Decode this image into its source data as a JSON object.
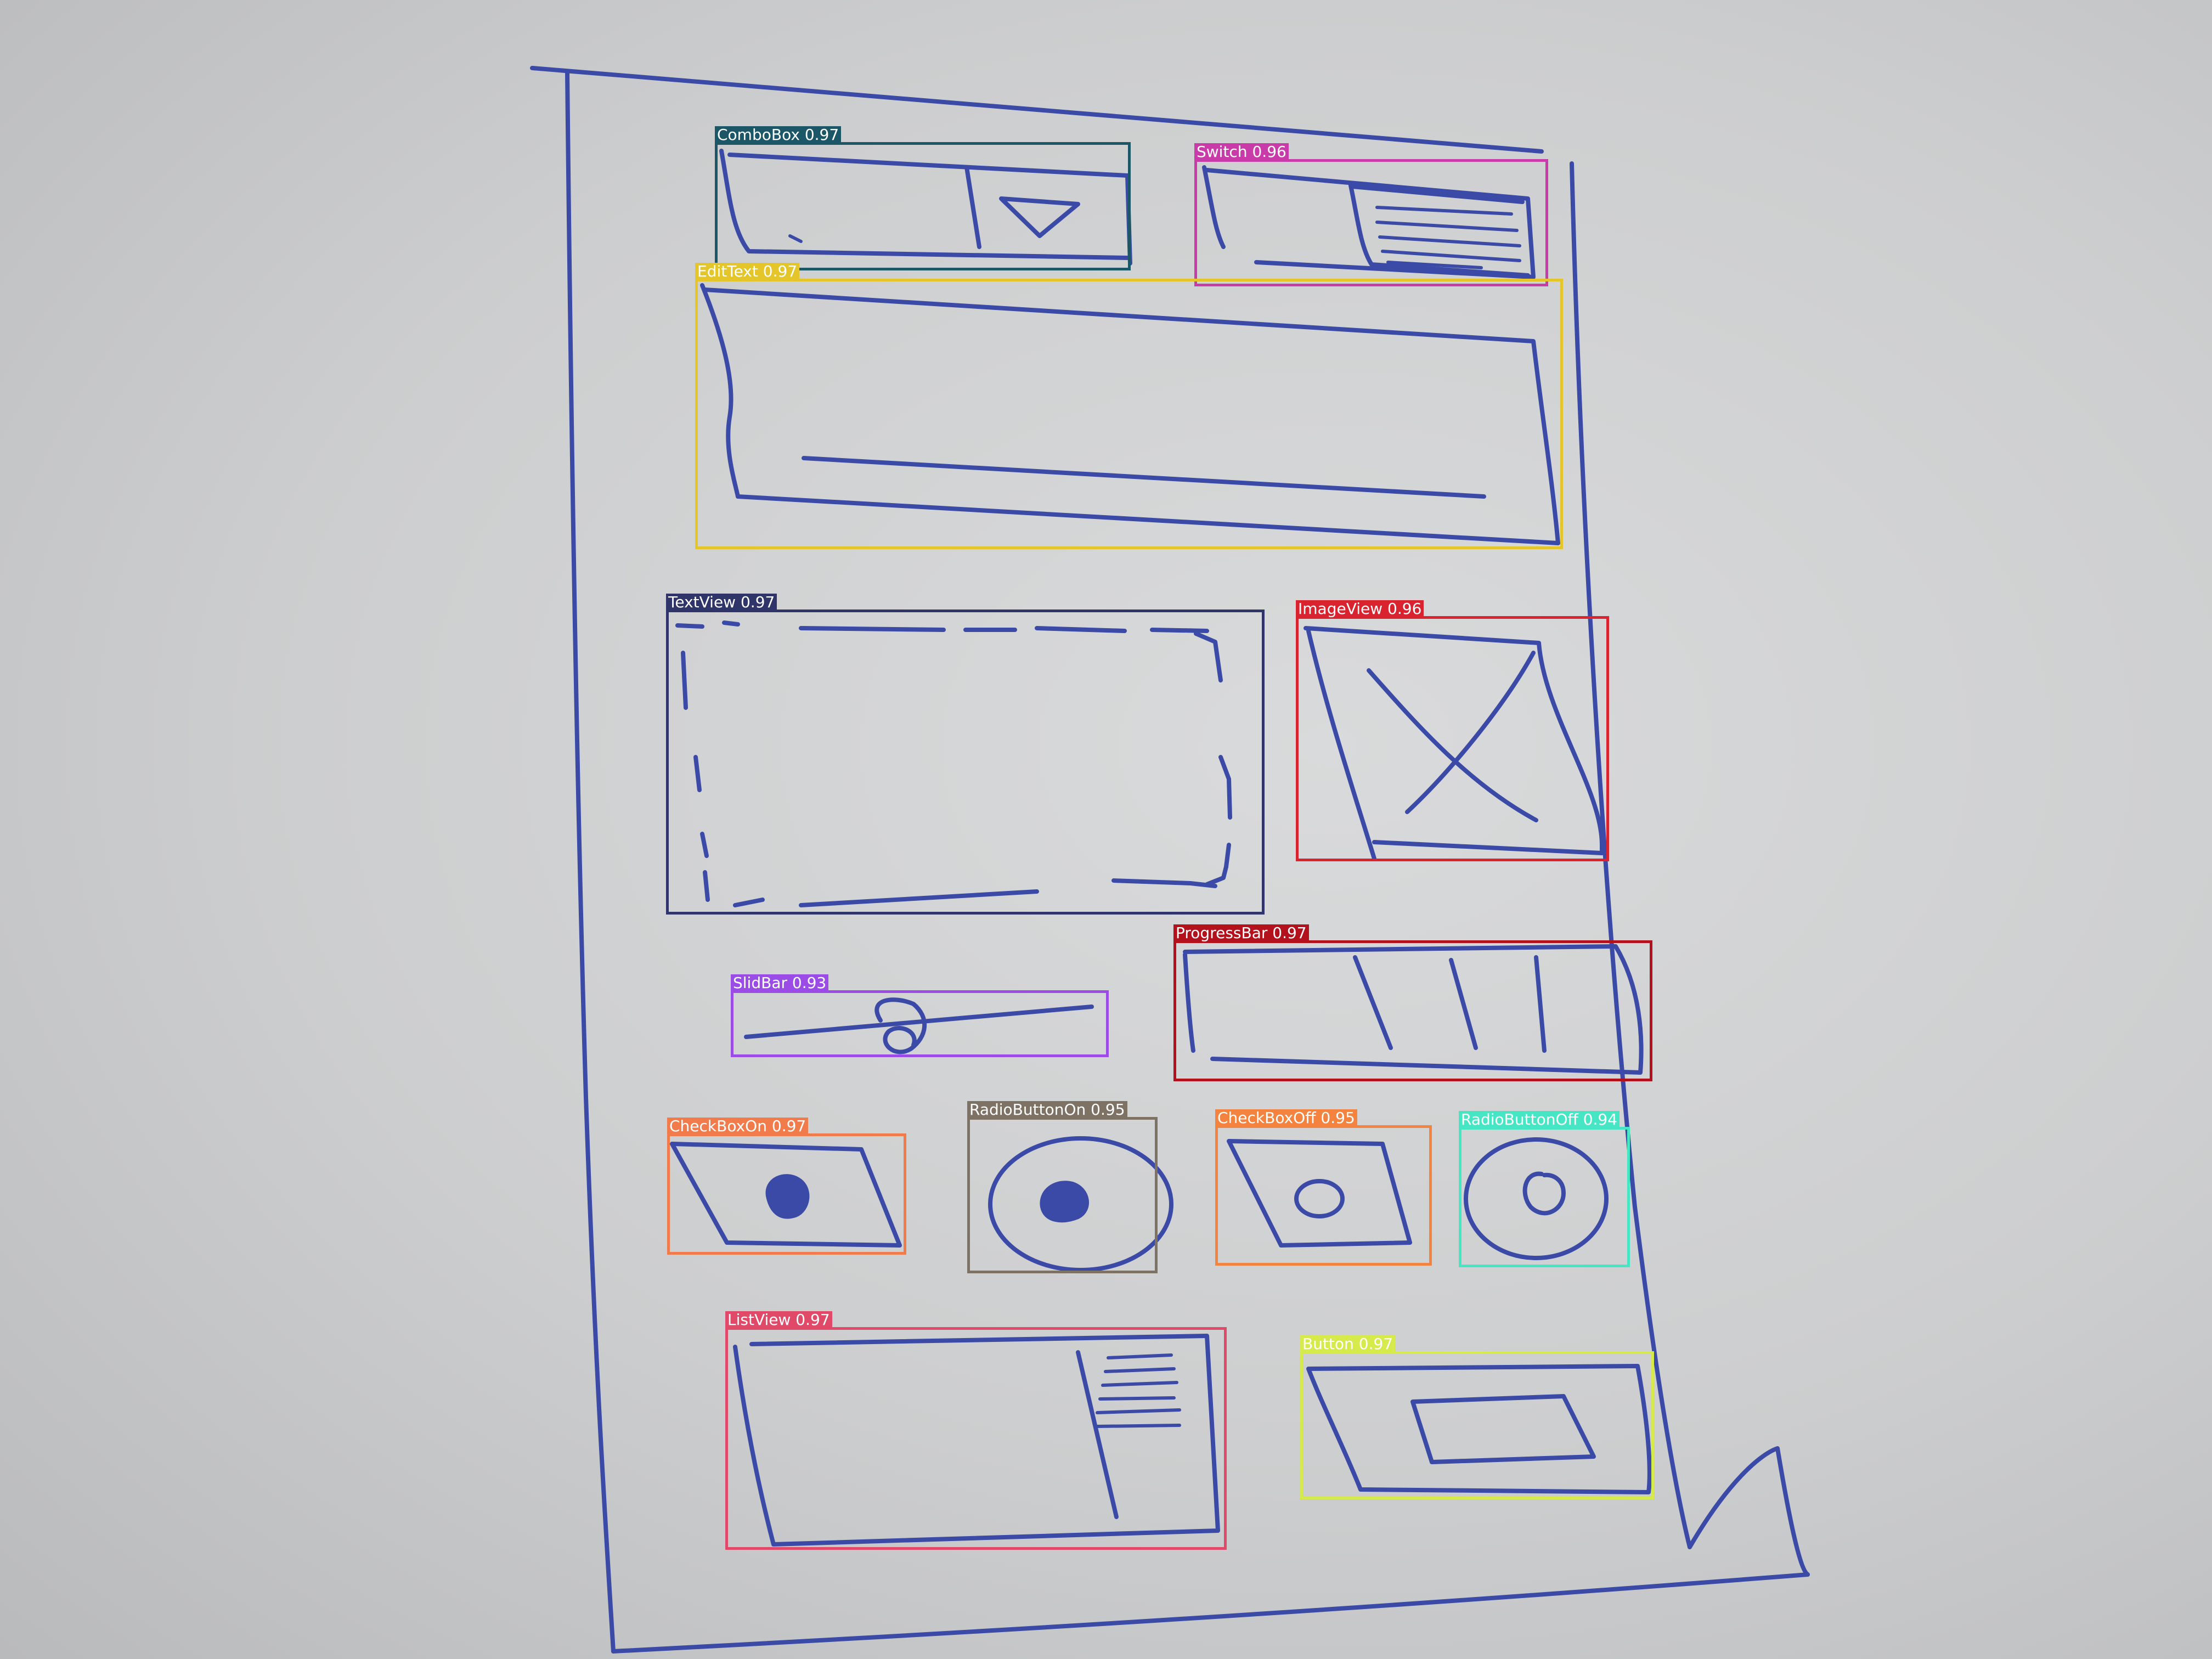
{
  "detections": [
    {
      "label": "ComboBox",
      "score": "0.97",
      "color": "#1b5766"
    },
    {
      "label": "Switch",
      "score": "0.96",
      "color": "#c93ba8"
    },
    {
      "label": "EditText",
      "score": "0.97",
      "color": "#e4c62a"
    },
    {
      "label": "TextView",
      "score": "0.97",
      "color": "#2f3469"
    },
    {
      "label": "ImageView",
      "score": "0.96",
      "color": "#d9232f"
    },
    {
      "label": "ProgressBar",
      "score": "0.97",
      "color": "#b3121d"
    },
    {
      "label": "SlidBar",
      "score": "0.93",
      "color": "#9b4be6"
    },
    {
      "label": "CheckBoxOn",
      "score": "0.97",
      "color": "#f27b4b"
    },
    {
      "label": "RadioButtonOn",
      "score": "0.95",
      "color": "#7d7264"
    },
    {
      "label": "CheckBoxOff",
      "score": "0.95",
      "color": "#f3833e"
    },
    {
      "label": "RadioButtonOff",
      "score": "0.94",
      "color": "#46e6c4"
    },
    {
      "label": "ListView",
      "score": "0.97",
      "color": "#e04a68"
    },
    {
      "label": "Button",
      "score": "0.97",
      "color": "#d6ea4c"
    }
  ],
  "colors": {
    "ink": "#3a4aa6",
    "paper": "#cdcecf"
  }
}
